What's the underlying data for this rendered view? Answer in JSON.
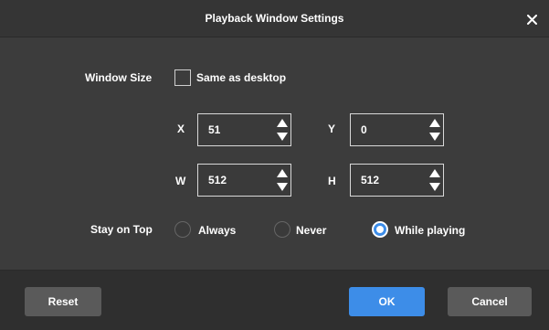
{
  "dialog": {
    "title": "Playback Window Settings",
    "close_icon": "close-icon"
  },
  "window_size": {
    "label": "Window Size",
    "same_as_desktop_label": "Same as desktop",
    "same_as_desktop_checked": false
  },
  "fields": {
    "x": {
      "label": "X",
      "value": "51"
    },
    "y": {
      "label": "Y",
      "value": "0"
    },
    "w": {
      "label": "W",
      "value": "512"
    },
    "h": {
      "label": "H",
      "value": "512"
    }
  },
  "stay_on_top": {
    "label": "Stay on Top",
    "options": [
      "Always",
      "Never",
      "While playing"
    ],
    "selected": "While playing"
  },
  "buttons": {
    "reset": "Reset",
    "ok": "OK",
    "cancel": "Cancel"
  },
  "colors": {
    "accent": "#3d8de8",
    "background": "#3c3c3c"
  }
}
